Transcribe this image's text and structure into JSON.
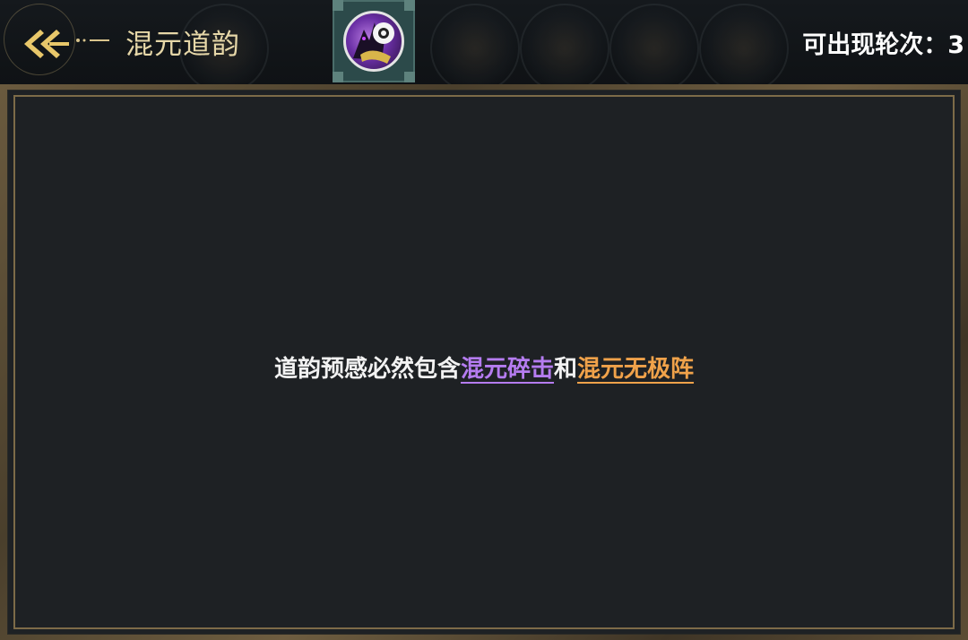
{
  "header": {
    "back_icon": "double-chevron-left-icon",
    "title": "混元道韵",
    "rounds_label": "可出现轮次：3",
    "skill_badge_icon": "mystic-beast-skill-icon"
  },
  "panel": {
    "hint_prefix": "道韵预感必然包含",
    "skill_a": "混元碎击",
    "conjunction": "和",
    "skill_b": "混元无极阵"
  },
  "colors": {
    "title": "#e6d7a8",
    "skill_a": "#b57cf0",
    "skill_b": "#f0a24a",
    "panel_bg": "#1e2124",
    "panel_frame": "#7d6b48"
  }
}
